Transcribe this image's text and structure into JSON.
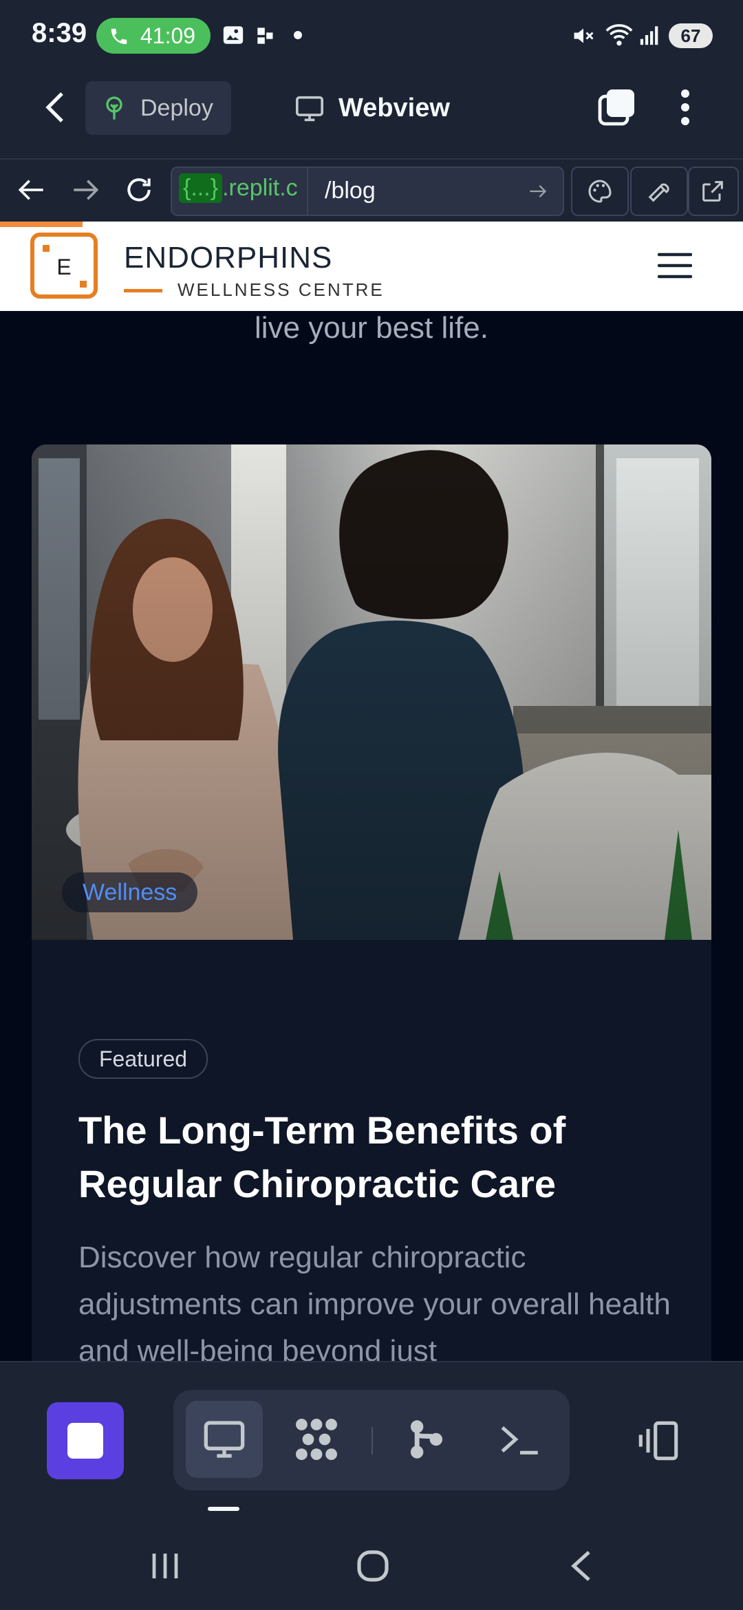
{
  "status_bar": {
    "time": "8:39",
    "call_timer": "41:09",
    "battery": "67",
    "icons": [
      "phone-icon",
      "image-icon",
      "app-icon",
      "dot-icon",
      "mute-icon",
      "wifi-icon",
      "signal-icon"
    ]
  },
  "app_header": {
    "deploy_label": "Deploy",
    "title": "Webview"
  },
  "url_bar": {
    "host_braces": "{...}",
    "host_text": ".replit.c",
    "path": "/blog"
  },
  "site": {
    "brand_letter": "E",
    "brand_name": "ENDORPHINS",
    "brand_sub": "WELLNESS CENTRE",
    "accent_color": "#e67e22"
  },
  "page": {
    "hero_tail": "live your best life.",
    "post": {
      "category": "Wellness",
      "badge": "Featured",
      "title": "The Long-Term Benefits of Regular Chiropractic Care",
      "excerpt": "Discover how regular chiropractic adjustments can improve your overall health and well-being beyond just"
    }
  },
  "colors": {
    "ide_bg": "#1c2333",
    "page_bg": "#020817",
    "card_bg": "#0f1627",
    "stop_button": "#5b3fe0",
    "link_blue": "#4f8ef7"
  }
}
